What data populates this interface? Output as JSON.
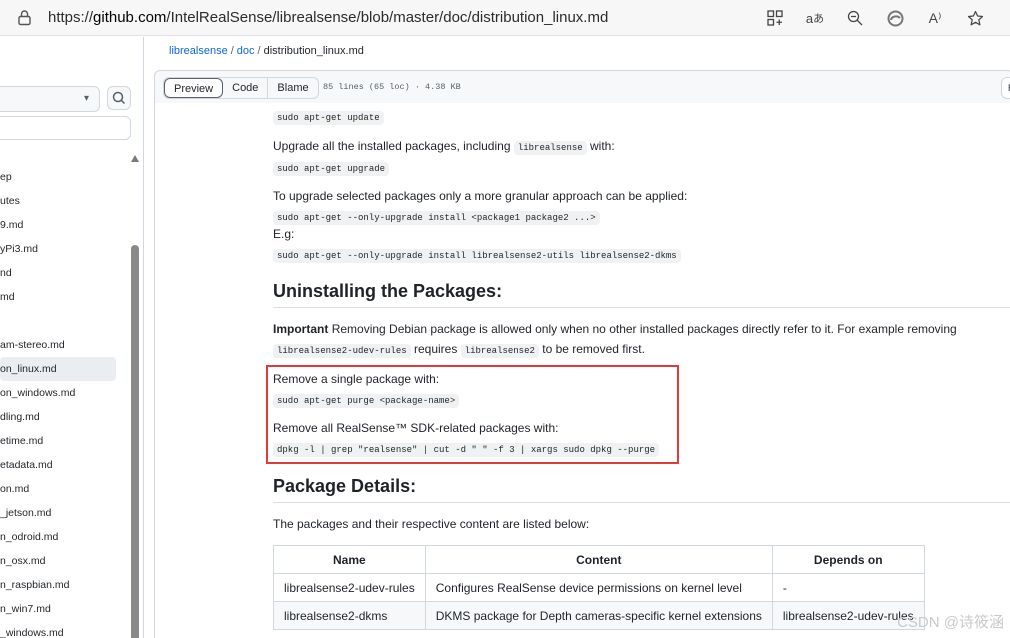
{
  "browser": {
    "url_scheme": "https://",
    "url_host": "github.com",
    "url_path": "/IntelRealSense/librealsense/blob/master/doc/distribution_linux.md",
    "read_aloud_label": "A⁾"
  },
  "sidebar": {
    "items": [
      "ep",
      "utes",
      "9.md",
      "yPi3.md",
      "nd",
      "md",
      "",
      "am-stereo.md",
      "on_linux.md",
      "on_windows.md",
      "dling.md",
      "etime.md",
      "etadata.md",
      "on.md",
      "_jetson.md",
      "n_odroid.md",
      "n_osx.md",
      "n_raspbian.md",
      "n_win7.md",
      "_windows.md"
    ],
    "active_index": 8
  },
  "breadcrumb": {
    "repo": "librealsense",
    "folder": "doc",
    "file": "distribution_linux.md"
  },
  "filebar": {
    "tabs": [
      "Preview",
      "Code",
      "Blame"
    ],
    "info": "85 lines (65 loc) · 4.38 KB",
    "raw_label": "Raw"
  },
  "markdown": {
    "code_update": "sudo apt-get update",
    "upgrade_all_pre": "Upgrade all the installed packages, including",
    "upgrade_all_code": "librealsense",
    "upgrade_all_post": "with:",
    "code_upgrade": "sudo apt-get upgrade",
    "granular_text": "To upgrade selected packages only a more granular approach can be applied:",
    "code_granular": "sudo apt-get --only-upgrade install <package1 package2 ...>",
    "eg": "E.g:",
    "code_eg": "sudo apt-get --only-upgrade install  librealsense2-utils librealsense2-dkms",
    "h_uninstall": "Uninstalling the Packages:",
    "important_bold": "Important",
    "important_text": "Removing Debian package is allowed only when no other installed packages directly refer to it. For example removing",
    "important_code1": "librealsense2-udev-rules",
    "important_mid": "requires",
    "important_code2": "librealsense2",
    "important_end": "to be removed first.",
    "remove_single": "Remove a single package with:",
    "code_purge": "sudo apt-get purge <package-name>",
    "remove_all": "Remove all RealSense™ SDK-related packages with:",
    "code_remove_all": "dpkg -l | grep \"realsense\" | cut -d \" \" -f 3 | xargs sudo dpkg --purge",
    "h_details": "Package Details:",
    "details_text": "The packages and their respective content are listed below:"
  },
  "table": {
    "headers": [
      "Name",
      "Content",
      "Depends on"
    ],
    "rows": [
      [
        "librealsense2-udev-rules",
        "Configures RealSense device permissions on kernel level",
        "-"
      ],
      [
        "librealsense2-dkms",
        "DKMS package for Depth cameras-specific kernel extensions",
        "librealsense2-udev-rules"
      ]
    ]
  },
  "watermark": "CSDN @诗筱涵",
  "colors": {
    "link": "#0969da",
    "highlight_box": "#e03b3b",
    "border": "#d0d7de"
  }
}
